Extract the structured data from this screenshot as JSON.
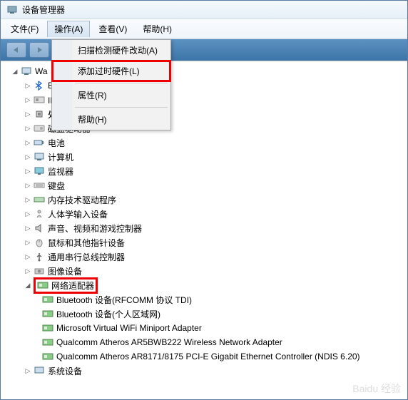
{
  "title": "设备管理器",
  "menubar": {
    "file": "文件(F)",
    "action": "操作(A)",
    "view": "查看(V)",
    "help": "帮助(H)"
  },
  "dropdown": {
    "scan": "扫描检测硬件改动(A)",
    "legacy": "添加过时硬件(L)",
    "props": "属性(R)",
    "help": "帮助(H)"
  },
  "tree": {
    "root": "Wa",
    "bluetooth": "B",
    "io": "IDE ATA/ATAPI 控制器",
    "processor": "处理器",
    "disk": "磁盘驱动器",
    "battery": "电池",
    "computer": "计算机",
    "monitor": "监视器",
    "keyboard": "键盘",
    "memory": "内存技术驱动程序",
    "hid": "人体学输入设备",
    "sound": "声音、视频和游戏控制器",
    "mouse": "鼠标和其他指针设备",
    "usb": "通用串行总线控制器",
    "imaging": "图像设备",
    "network": "网络适配器",
    "net1": "Bluetooth 设备(RFCOMM 协议 TDI)",
    "net2": "Bluetooth 设备(个人区域网)",
    "net3": "Microsoft Virtual WiFi Miniport Adapter",
    "net4": "Qualcomm Atheros AR5BWB222 Wireless Network Adapter",
    "net5": "Qualcomm Atheros AR8171/8175 PCI-E Gigabit Ethernet Controller (NDIS 6.20)",
    "system": "系统设备"
  },
  "watermark": "Baidu 经验"
}
